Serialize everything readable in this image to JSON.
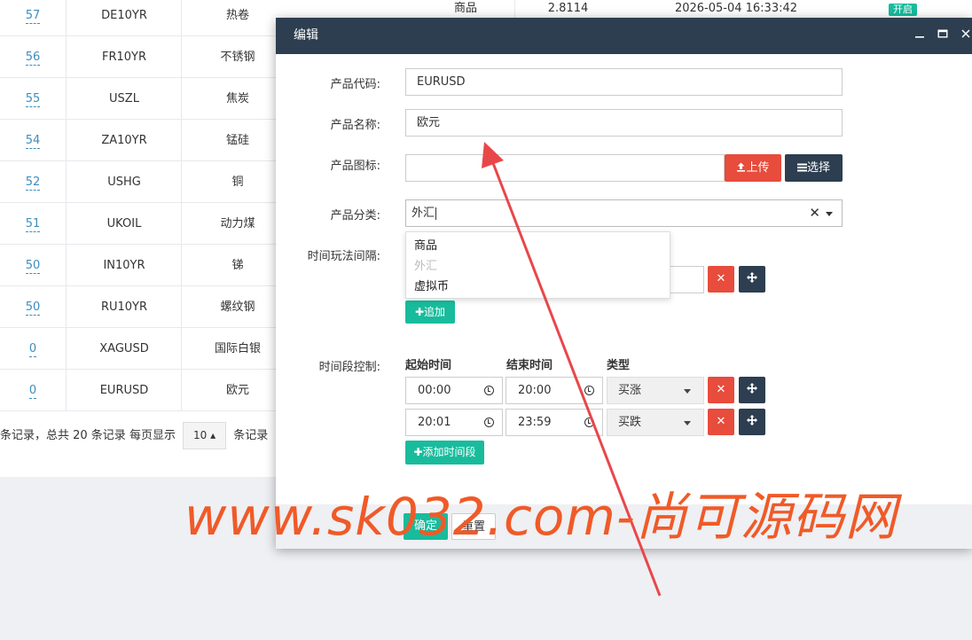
{
  "background_table": {
    "rows": [
      {
        "id": "57",
        "code": "DE10YR",
        "name": "热卷",
        "category": "商品",
        "value": "2.8114",
        "time": "2026-05-04 16:33:42",
        "status": "开启"
      },
      {
        "id": "56",
        "code": "FR10YR",
        "name": "不锈钢"
      },
      {
        "id": "55",
        "code": "USZL",
        "name": "焦炭"
      },
      {
        "id": "54",
        "code": "ZA10YR",
        "name": "锰硅"
      },
      {
        "id": "52",
        "code": "USHG",
        "name": "铜"
      },
      {
        "id": "51",
        "code": "UKOIL",
        "name": "动力煤"
      },
      {
        "id": "50",
        "code": "IN10YR",
        "name": "锑"
      },
      {
        "id": "50",
        "code": "RU10YR",
        "name": "螺纹钢"
      },
      {
        "id": "0",
        "code": "XAGUSD",
        "name": "国际白银"
      },
      {
        "id": "0",
        "code": "EURUSD",
        "name": "欧元"
      }
    ],
    "pager": {
      "text_before": "条记录，总共 20 条记录 每页显示",
      "page_size": "10",
      "text_after": "条记录"
    }
  },
  "modal": {
    "title": "编辑",
    "fields": {
      "code_label": "产品代码:",
      "code_value": "EURUSD",
      "name_label": "产品名称:",
      "name_value": "欧元",
      "icon_label": "产品图标:",
      "upload_label": "上传",
      "choose_label": "选择",
      "category_label": "产品分类:",
      "category_value": "外汇",
      "category_options": [
        "商品",
        "外汇",
        "虚拟币"
      ],
      "interval_label": "时间玩法间隔:",
      "add_label": "追加"
    },
    "time_control": {
      "label": "时间段控制:",
      "headers": {
        "start": "起始时间",
        "end": "结束时间",
        "type": "类型"
      },
      "rows": [
        {
          "start": "00:00",
          "end": "20:00",
          "type": "买涨"
        },
        {
          "start": "20:01",
          "end": "23:59",
          "type": "买跌"
        }
      ],
      "add_period_label": "添加时间段"
    },
    "footer": {
      "confirm_label": "确定",
      "reset_label": "重置"
    }
  },
  "watermark": "www.sk032.com-尚可源码网",
  "colors": {
    "header_bg": "#2c3e50",
    "danger": "#e74c3c",
    "success": "#18bc9c",
    "link": "#3c8dbc",
    "watermark": "#f05a28",
    "arrow": "#e8474a"
  }
}
